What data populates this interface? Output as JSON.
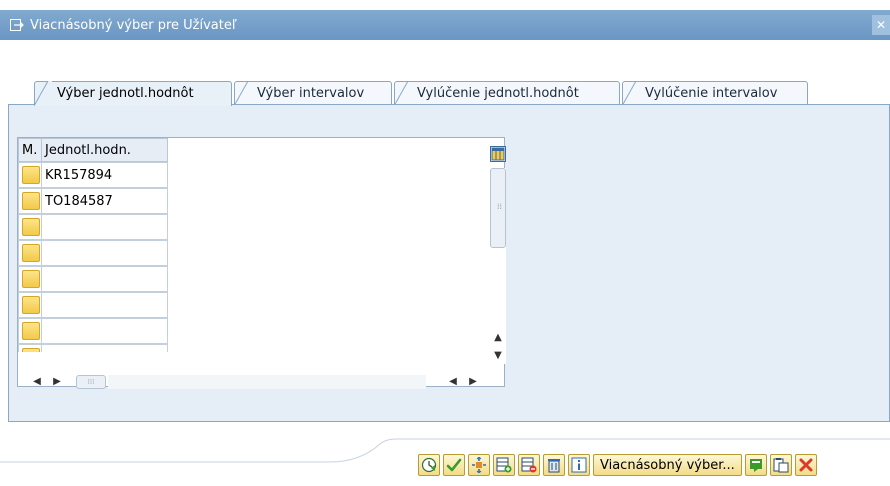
{
  "window": {
    "title": "Viacnásobný výber pre Užívateľ",
    "close_glyph": "✕"
  },
  "tabs": [
    {
      "label": "Výber jednotl.hodnôt",
      "active": true
    },
    {
      "label": "Výber intervalov",
      "active": false
    },
    {
      "label": "Vylúčenie jednotl.hodnôt",
      "active": false
    },
    {
      "label": "Vylúčenie intervalov",
      "active": false
    }
  ],
  "grid": {
    "headers": {
      "mark": "M.",
      "value": "Jednotl.hodn."
    },
    "rows": [
      "KR157894",
      "TO184587",
      "",
      "",
      "",
      "",
      "",
      ""
    ]
  },
  "toolbar": {
    "buttons": [
      {
        "name": "execute-button",
        "icon": "clock-execute-icon"
      },
      {
        "name": "confirm-button",
        "icon": "checkmark-icon"
      },
      {
        "name": "variants-button",
        "icon": "variant-icon"
      },
      {
        "name": "insert-row-button",
        "icon": "insert-row-icon"
      },
      {
        "name": "delete-row-button",
        "icon": "delete-row-icon"
      },
      {
        "name": "delete-all-button",
        "icon": "trash-icon"
      },
      {
        "name": "info-button",
        "icon": "info-icon"
      }
    ],
    "multi_select_label": "Viacnásobný výber...",
    "after_buttons": [
      {
        "name": "copy-button",
        "icon": "copy-icon"
      },
      {
        "name": "paste-button",
        "icon": "paste-icon"
      },
      {
        "name": "cancel-button",
        "icon": "cancel-icon"
      }
    ]
  },
  "colors": {
    "titlebar": "#7aa3cb",
    "panel": "#e5eef7",
    "row_marker": "#f6d160",
    "cancel_red": "#d83a2c",
    "confirm_green": "#3c9a2a"
  }
}
